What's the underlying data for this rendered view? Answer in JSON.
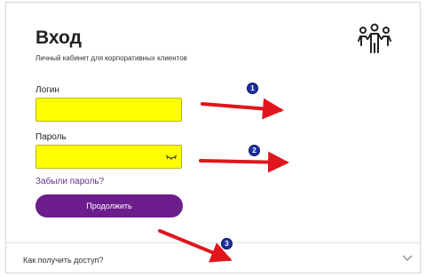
{
  "page": {
    "title": "Вход",
    "subtitle": "Личный кабинет для корпоративных клиентов"
  },
  "form": {
    "login_label": "Логин",
    "login_value": "",
    "password_label": "Пароль",
    "password_value": "",
    "forgot_link": "Забыли пароль?",
    "submit_label": "Продолжить"
  },
  "footer": {
    "access_label": "Как получить доступ?"
  },
  "annotations": {
    "badges": [
      "1",
      "2",
      "3"
    ]
  },
  "colors": {
    "field_highlight": "#ffff00",
    "button": "#6b1d8c",
    "link": "#6a2d8f",
    "arrow": "#e0161c",
    "badge": "#1f2f9f"
  },
  "icons": {
    "header": "people-icon",
    "password_toggle": "eye-icon",
    "expand": "chevron-down-icon"
  }
}
